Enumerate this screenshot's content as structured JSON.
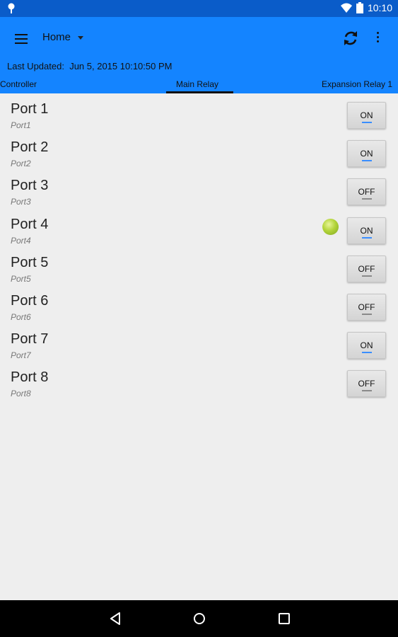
{
  "status_bar": {
    "time": "10:10",
    "icons": [
      "notification-icon",
      "wifi-icon",
      "battery-icon"
    ]
  },
  "app_bar": {
    "spinner_label": "Home",
    "last_updated_label": "Last Updated:",
    "last_updated_value": "Jun 5, 2015 10:10:50 PM",
    "tabs": [
      {
        "label": "Controller"
      },
      {
        "label": "Main Relay"
      },
      {
        "label": "Expansion Relay 1"
      }
    ],
    "accent": "#1484ff"
  },
  "ports": [
    {
      "name": "Port 1",
      "sub": "Port1",
      "state": "ON",
      "led": false
    },
    {
      "name": "Port 2",
      "sub": "Port2",
      "state": "ON",
      "led": false
    },
    {
      "name": "Port 3",
      "sub": "Port3",
      "state": "OFF",
      "led": false
    },
    {
      "name": "Port 4",
      "sub": "Port4",
      "state": "ON",
      "led": true
    },
    {
      "name": "Port 5",
      "sub": "Port5",
      "state": "OFF",
      "led": false
    },
    {
      "name": "Port 6",
      "sub": "Port6",
      "state": "OFF",
      "led": false
    },
    {
      "name": "Port 7",
      "sub": "Port7",
      "state": "ON",
      "led": false
    },
    {
      "name": "Port 8",
      "sub": "Port8",
      "state": "OFF",
      "led": false
    }
  ],
  "nav_bar": {
    "icons": [
      "back-icon",
      "home-icon",
      "recents-icon"
    ]
  }
}
